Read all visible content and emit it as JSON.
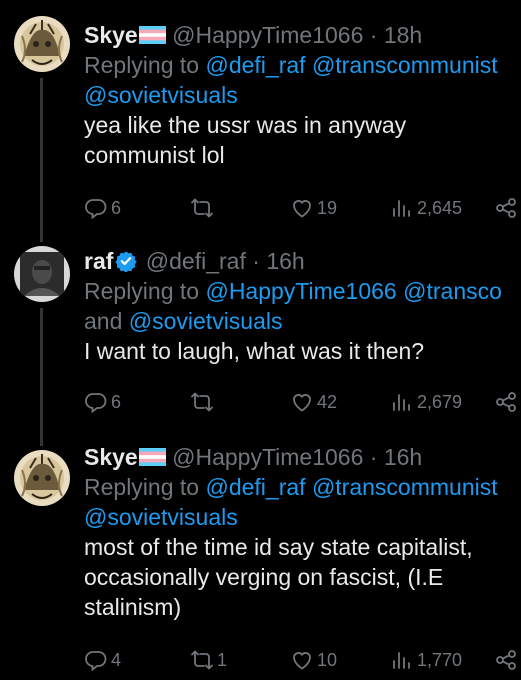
{
  "tweets": [
    {
      "name": "Skye",
      "handle": "@HappyTime1066",
      "separator": "·",
      "time": "18h",
      "replying_prefix": "Replying to",
      "mention_1": "@defi_raf",
      "mention_2": "@transcommunist",
      "reply_line2": "@sovietvisuals",
      "text_lines": [
        "yea like the ussr was in anyway",
        "communist lol"
      ],
      "replies": "6",
      "reposts": "",
      "likes": "19",
      "views": "2,645"
    },
    {
      "name": "raf",
      "handle": "@defi_raf",
      "separator": "·",
      "time": "16h",
      "replying_prefix": "Replying to",
      "mention_1": "@HappyTime1066",
      "mention_2": "@transco",
      "reply_line2_prefix": "and",
      "reply_line2": "@sovietvisuals",
      "text_lines": [
        "I want to laugh, what was it then?"
      ],
      "replies": "6",
      "reposts": "",
      "likes": "42",
      "views": "2,679"
    },
    {
      "name": "Skye",
      "handle": "@HappyTime1066",
      "separator": "·",
      "time": "16h",
      "replying_prefix": "Replying to",
      "mention_1": "@defi_raf",
      "mention_2": "@transcommunist",
      "reply_line2": "@sovietvisuals",
      "text_lines": [
        "most of the time id say state capitalist,",
        "occasionally verging on fascist, (I.E",
        "stalinism)"
      ],
      "replies": "4",
      "reposts": "1",
      "likes": "10",
      "views": "1,770"
    }
  ],
  "icons": {
    "reply": "reply-icon",
    "repost": "repost-icon",
    "like": "heart-icon",
    "views": "views-icon",
    "share": "share-icon",
    "verified": "verified-badge-icon",
    "flag": "trans-flag-icon"
  },
  "colors": {
    "background": "#000000",
    "text": "#e7e9ea",
    "muted": "#71767b",
    "link": "#1d9bf0"
  }
}
